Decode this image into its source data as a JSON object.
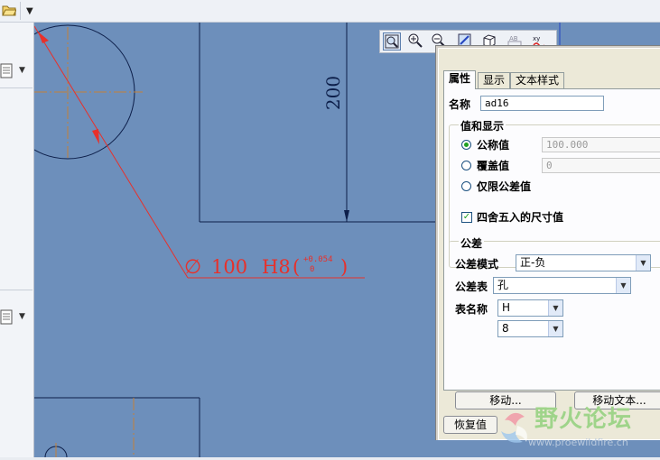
{
  "drawing": {
    "vertical_dim": "200",
    "diameter_symbol": "∅",
    "diameter_value": "100",
    "fit_code": "H8",
    "tolerance_open_paren": "(",
    "tolerance_upper": "+0.054",
    "tolerance_lower": "0",
    "tolerance_close_paren": ")"
  },
  "dialog": {
    "tabs": [
      "属性",
      "显示",
      "文本样式"
    ],
    "active_tab": 0,
    "name_label": "名称",
    "name_value": "ad16",
    "value_display_group": "值和显示",
    "radio_nominal": "公称值",
    "nominal_value": "100.000",
    "radio_override": "覆盖值",
    "override_value": "0",
    "radio_tolerance_only": "仅限公差值",
    "round_checkbox": "四舍五入的尺寸值",
    "round_checked": true,
    "tolerance_group": "公差",
    "tolerance_mode_label": "公差模式",
    "tolerance_mode_value": "正-负",
    "tolerance_table_label": "公差表",
    "tolerance_table_value": "孔",
    "table_name_label": "表名称",
    "table_name_value": "H",
    "grade_value": "8",
    "move_button": "移动...",
    "move_text_button": "移动文本...",
    "restore_button": "恢复值"
  },
  "watermark": {
    "title": "野火论坛",
    "url": "www.proewildfire.cn"
  },
  "colors": {
    "canvas": "#6d8fbb",
    "geometry": "#0d1f4a",
    "dimension": "#e8302a",
    "dialog": "#ece9d8"
  },
  "icons": [
    "folder-open-icon",
    "zoom-fit-icon",
    "zoom-in-icon",
    "zoom-out-icon",
    "repaint-icon",
    "view-orient-icon",
    "text-icon",
    "annotation-icon",
    "note-icon"
  ]
}
